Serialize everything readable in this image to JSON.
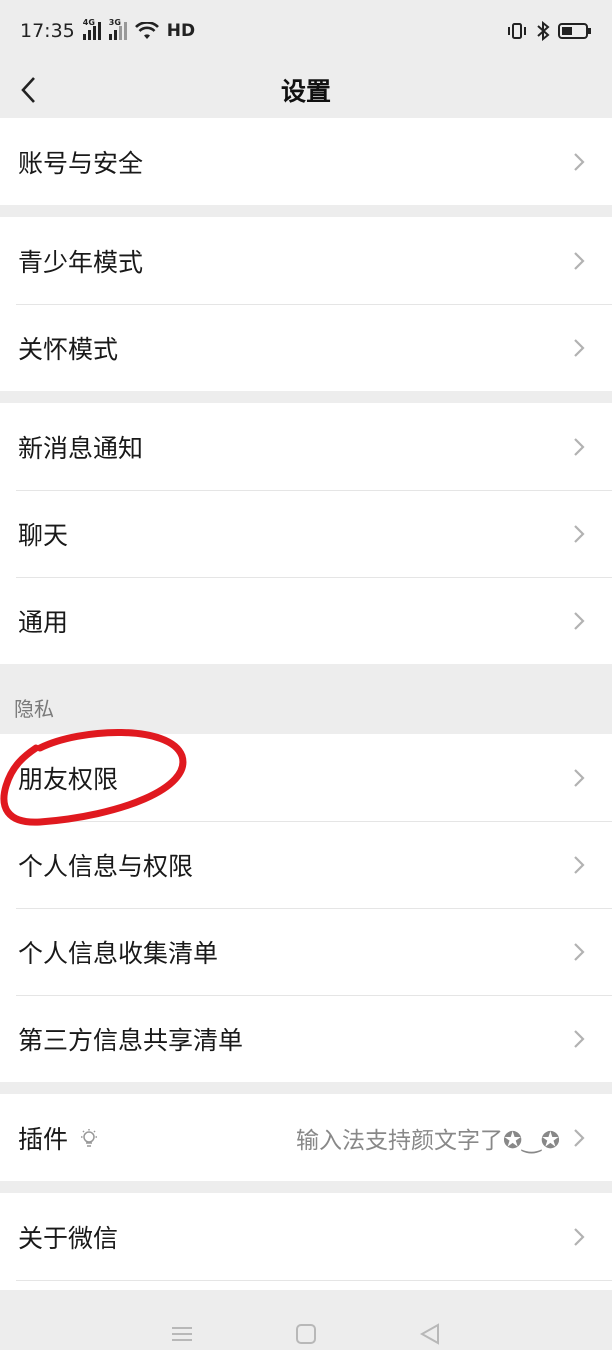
{
  "status": {
    "time": "17:35",
    "net_a": "4G",
    "net_b": "3G",
    "hd": "HD"
  },
  "header": {
    "title": "设置"
  },
  "groups": [
    {
      "items": [
        {
          "label": "账号与安全"
        }
      ]
    },
    {
      "items": [
        {
          "label": "青少年模式"
        },
        {
          "label": "关怀模式"
        }
      ]
    },
    {
      "items": [
        {
          "label": "新消息通知"
        },
        {
          "label": "聊天"
        },
        {
          "label": "通用"
        }
      ]
    }
  ],
  "privacy": {
    "title": "隐私",
    "items": [
      {
        "label": "朋友权限"
      },
      {
        "label": "个人信息与权限"
      },
      {
        "label": "个人信息收集清单"
      },
      {
        "label": "第三方信息共享清单"
      }
    ]
  },
  "plugins": {
    "label": "插件",
    "hint": "输入法支持颜文字了✪‿✪"
  },
  "about": {
    "label": "关于微信"
  },
  "annotation_color": "#e0191f",
  "icons": [
    "back-arrow-icon",
    "chevron-right-icon",
    "bulb-icon",
    "wifi-icon",
    "bluetooth-icon",
    "battery-icon",
    "vibrate-icon",
    "menu-icon",
    "home-icon",
    "back-triangle-icon"
  ]
}
